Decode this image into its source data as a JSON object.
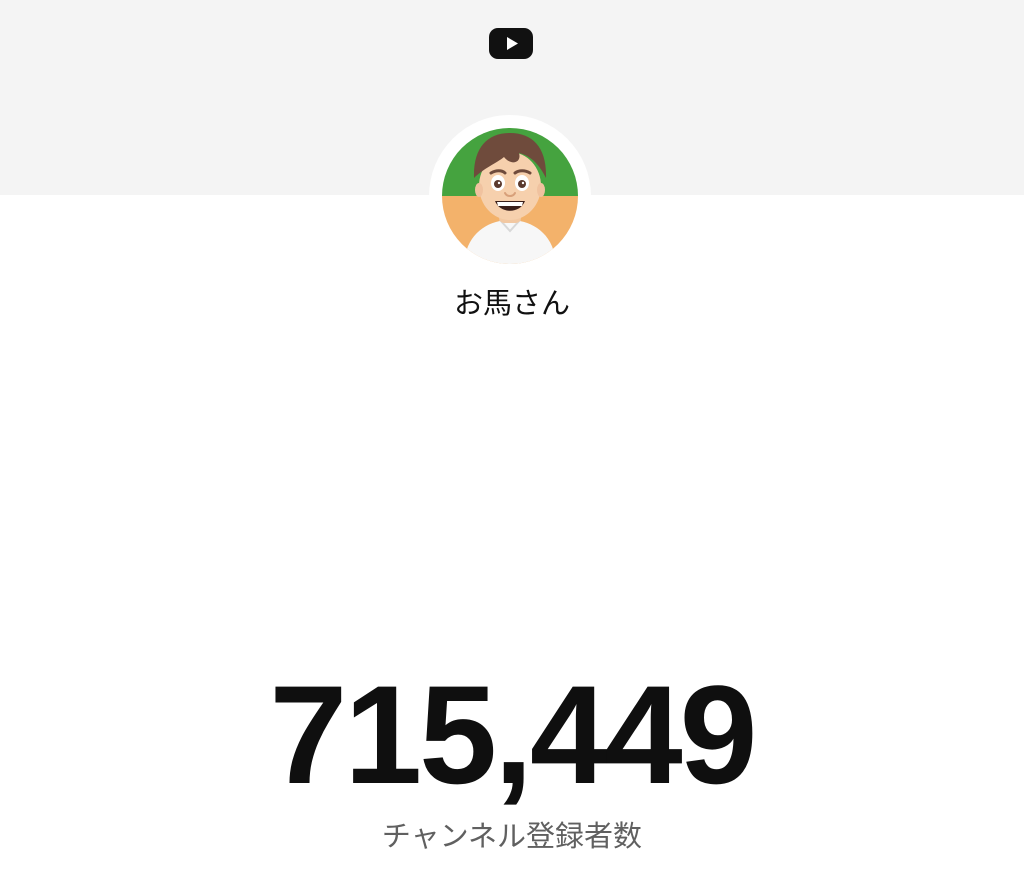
{
  "header": {
    "logo_icon": "youtube-play-icon",
    "background_color": "#f4f4f4"
  },
  "channel": {
    "name": "お馬さん",
    "avatar_icon": "memoji-avatar"
  },
  "stats": {
    "subscriber_count": "715,449",
    "subscriber_label": "チャンネル登録者数"
  },
  "colors": {
    "logo": "#111111",
    "avatar_top": "#45a33f",
    "avatar_bottom": "#f3b26b",
    "count": "#0f0f0f",
    "label": "#606060"
  }
}
